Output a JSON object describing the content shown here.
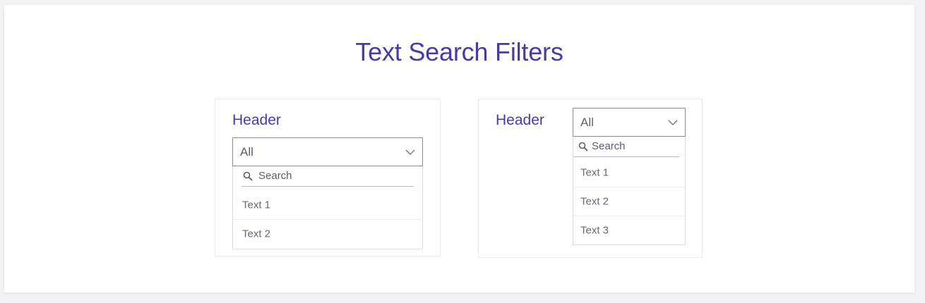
{
  "page": {
    "title": "Text Search Filters"
  },
  "filter_stacked": {
    "header": "Header",
    "selected": "All",
    "search_placeholder": "Search",
    "options": [
      "Text 1",
      "Text 2"
    ]
  },
  "filter_inline": {
    "header": "Header",
    "selected": "All",
    "search_placeholder": "Search",
    "options": [
      "Text 1",
      "Text 2",
      "Text 3"
    ]
  },
  "colors": {
    "accent": "#4b3aa6",
    "border": "#8c8f98",
    "text": "#5b5f6b"
  },
  "icons": {
    "chevron": "chevron-down-icon",
    "search": "search-icon"
  }
}
